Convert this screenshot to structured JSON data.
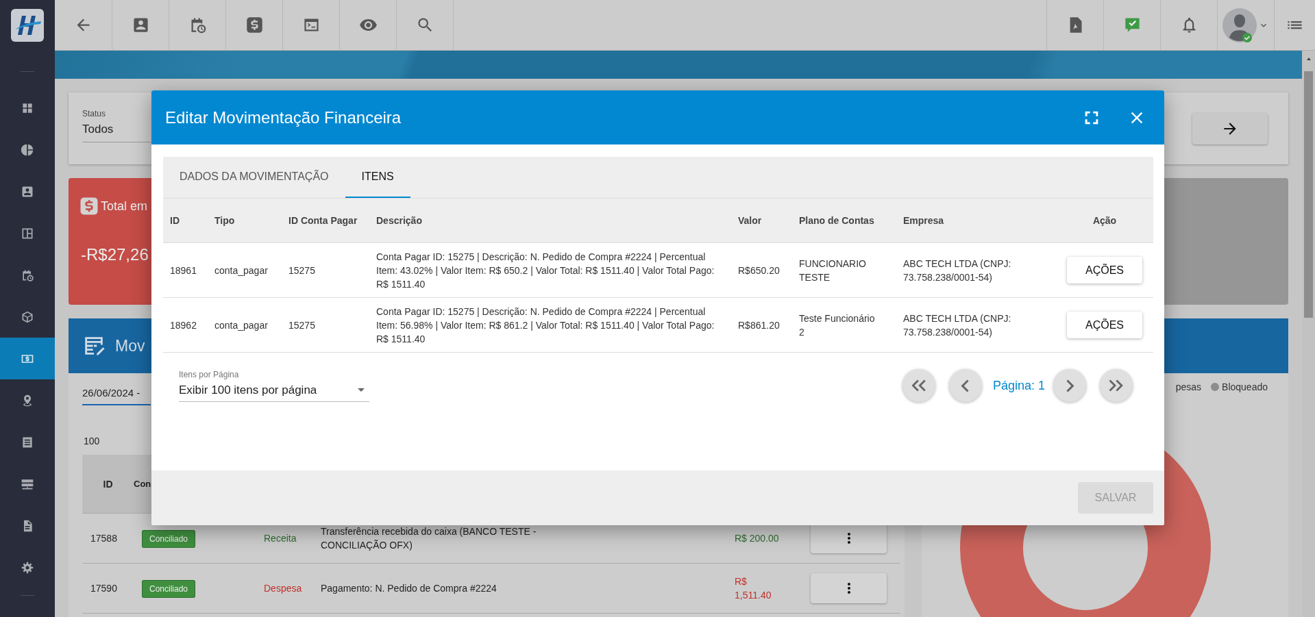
{
  "sidebar": {
    "items": [
      {
        "selected": false
      },
      {
        "selected": false
      },
      {
        "selected": false
      },
      {
        "selected": false
      },
      {
        "selected": false
      },
      {
        "selected": false
      },
      {
        "selected": true
      },
      {
        "selected": false
      },
      {
        "selected": false
      },
      {
        "selected": false
      },
      {
        "selected": false
      },
      {
        "selected": false
      }
    ]
  },
  "page": {
    "status_filter": {
      "label": "Status",
      "value": "Todos"
    },
    "total_card": {
      "title": "Total em",
      "amount": "-R$27,26"
    },
    "movements_panel": {
      "title": "Mov",
      "date_range": "26/06/2024 -",
      "page_size": "100",
      "columns": [
        "ID",
        "Con"
      ],
      "rows": [
        {
          "id": "17588",
          "status": "Conciliado",
          "type": "Receita",
          "kind": "income",
          "description": "Transferência recebida do caixa (BANCO TESTE - CONCILIAÇÃO OFX)",
          "amount": "R$ 200.00"
        },
        {
          "id": "17590",
          "status": "Conciliado",
          "type": "Despesa",
          "kind": "expense",
          "description": "Pagamento: N. Pedido de Compra #2224",
          "amount": "R$ 1,511.40"
        }
      ]
    },
    "chart_panel": {
      "legend": [
        {
          "label": "pesas"
        },
        {
          "label": "Bloqueado",
          "color": "#8c8c8c"
        }
      ]
    }
  },
  "modal": {
    "title": "Editar Movimentação Financeira",
    "tabs": [
      {
        "label": "DADOS DA MOVIMENTAÇÃO",
        "selected": false
      },
      {
        "label": "ITENS",
        "selected": true
      }
    ],
    "table": {
      "columns": [
        "ID",
        "Tipo",
        "ID Conta Pagar",
        "Descrição",
        "Valor",
        "Plano de Contas",
        "Empresa",
        "Ação"
      ],
      "rows": [
        {
          "cells": [
            "18961",
            "conta_pagar",
            "15275",
            "Conta Pagar ID: 15275 | Descrição: N. Pedido de Compra #2224 | Percentual Item: 43.02% | Valor Item: R$ 650.2 | Valor Total: R$ 1511.40 | Valor Total Pago: R$ 1511.40",
            "R$650.20",
            "FUNCIONARIO TESTE",
            "ABC TECH LTDA (CNPJ: 73.758.238/0001-54)"
          ],
          "action": "AÇÕES"
        },
        {
          "cells": [
            "18962",
            "conta_pagar",
            "15275",
            "Conta Pagar ID: 15275 | Descrição: N. Pedido de Compra #2224 | Percentual Item: 56.98% | Valor Item: R$ 861.2 | Valor Total: R$ 1511.40 | Valor Total Pago: R$ 1511.40",
            "R$861.20",
            "Teste Funcionário 2",
            "ABC TECH LTDA (CNPJ: 73.758.238/0001-54)"
          ],
          "action": "AÇÕES"
        }
      ]
    },
    "pagination": {
      "label": "Itens por Página",
      "value": "Exibir 100 itens por página",
      "page": "Página: 1"
    },
    "save_button": {
      "label": "SALVAR",
      "disabled": true
    }
  }
}
